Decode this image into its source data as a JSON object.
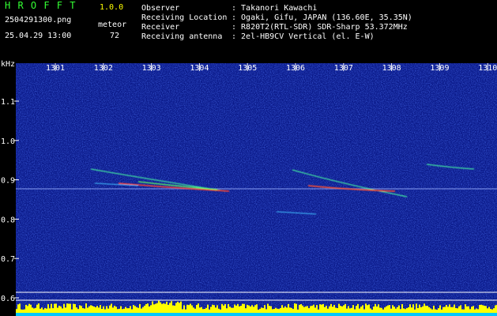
{
  "header": {
    "app_name": "H R O F F T",
    "version": "1.0.0",
    "filename": "2504291300.png",
    "mode_label": "meteor",
    "datetime": "25.04.29 13:00",
    "count": "72",
    "info": [
      {
        "label": "Observer",
        "value": ": Takanori Kawachi"
      },
      {
        "label": "Receiving Location",
        "value": ": Ogaki, Gifu, JAPAN (136.60E, 35.35N)"
      },
      {
        "label": "Receiver",
        "value": ": R820T2(RTL-SDR) SDR-Sharp 53.372MHz"
      },
      {
        "label": "Receiving antenna",
        "value": ": 2el-HB9CV Vertical (el. E-W)"
      }
    ]
  },
  "chart_data": {
    "type": "heatmap",
    "unit_label": "kHz",
    "x_ticks": [
      "1301",
      "1302",
      "1303",
      "1304",
      "1305",
      "1306",
      "1307",
      "1308",
      "1309",
      "1310"
    ],
    "y_ticks": [
      "1.1",
      "1.0",
      "0.9",
      "0.8",
      "0.7",
      "0.6"
    ],
    "y_values": [
      1.1,
      1.0,
      0.9,
      0.8,
      0.7,
      0.6
    ],
    "colors": {
      "background": "#0b1a8a",
      "noise": "#3050d0",
      "signal_hot": "#ff3020",
      "signal_mid": "#40ff60",
      "bar": "#ffff00",
      "bar_base": "#00c8ff"
    }
  }
}
